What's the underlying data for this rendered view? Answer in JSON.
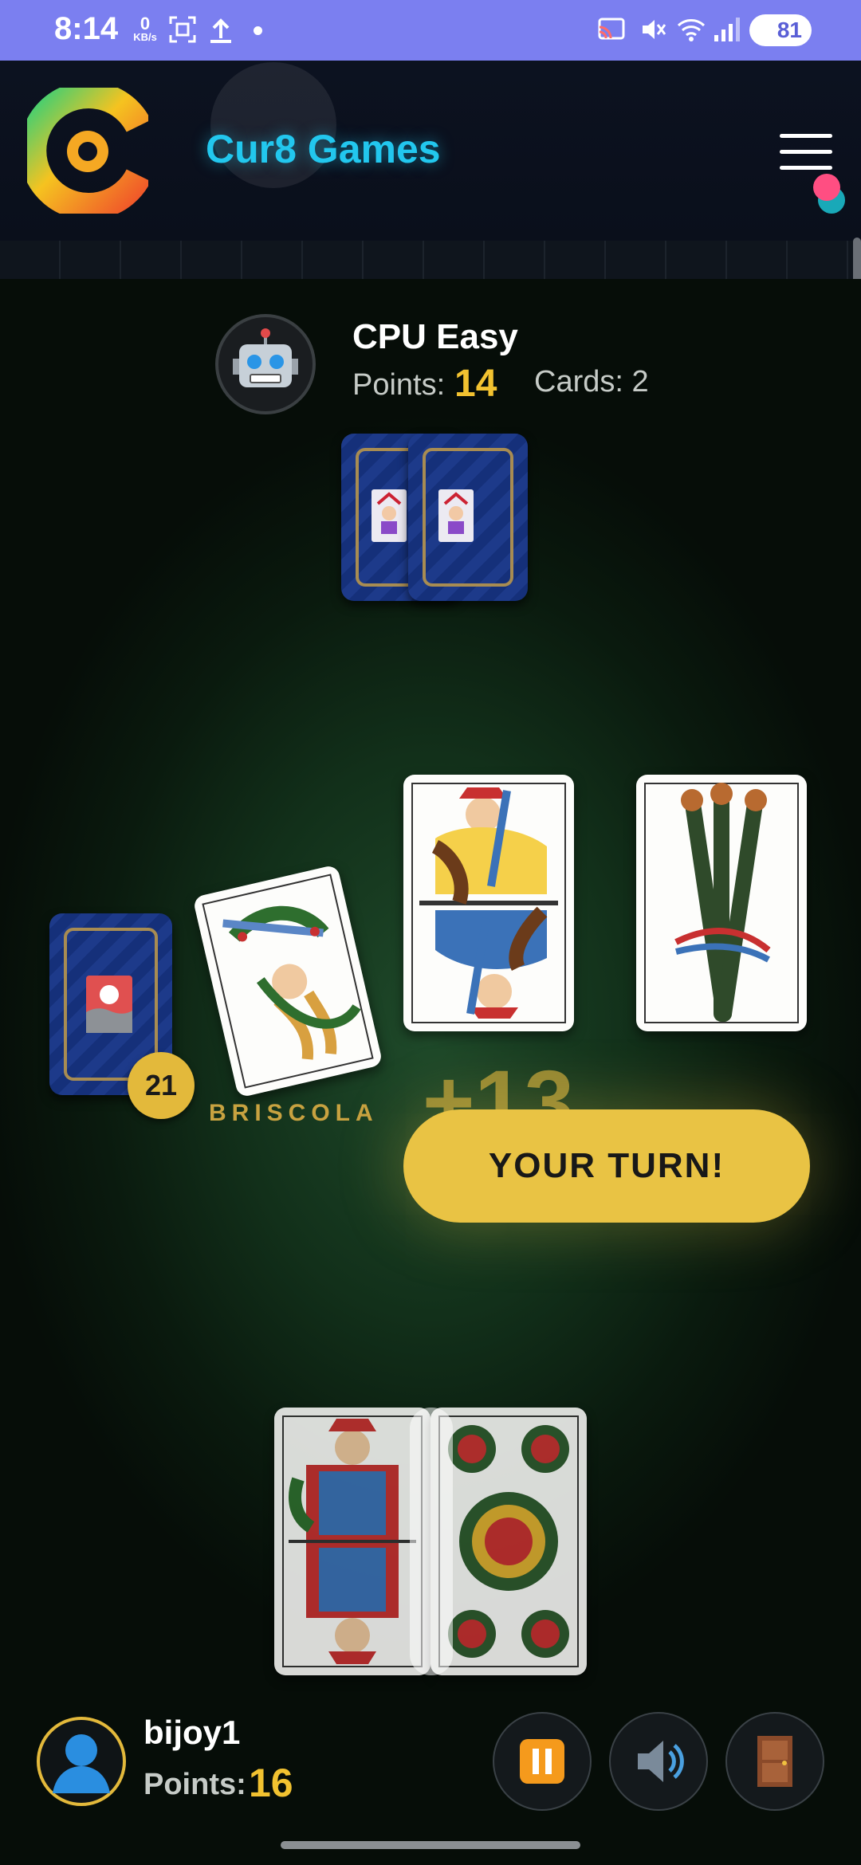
{
  "status_bar": {
    "time": "8:14",
    "net_speed_value": "0",
    "net_speed_unit": "KB/s",
    "battery": "81",
    "bg_color": "#7b7ff0"
  },
  "header": {
    "brand": "Cur8 Games",
    "brand_color": "#22c7ee"
  },
  "opponent": {
    "name": "CPU Easy",
    "points_label": "Points:",
    "points": "14",
    "cards_text": "Cards: 2"
  },
  "deck": {
    "remaining": "21",
    "trump_label": "BRISCOLA"
  },
  "play": {
    "score_popup": "+13",
    "turn_message": "YOUR TURN!"
  },
  "player": {
    "name": "bijoy1",
    "points_label": "Points:",
    "points": "16"
  },
  "controls": [
    {
      "name": "pause",
      "icon": "pause-icon"
    },
    {
      "name": "sound",
      "icon": "speaker-icon"
    },
    {
      "name": "exit",
      "icon": "door-icon"
    }
  ],
  "colors": {
    "accent_gold": "#f2c230",
    "table_green": "#1f4a2a",
    "card_back_blue": "#1d3a8a"
  }
}
